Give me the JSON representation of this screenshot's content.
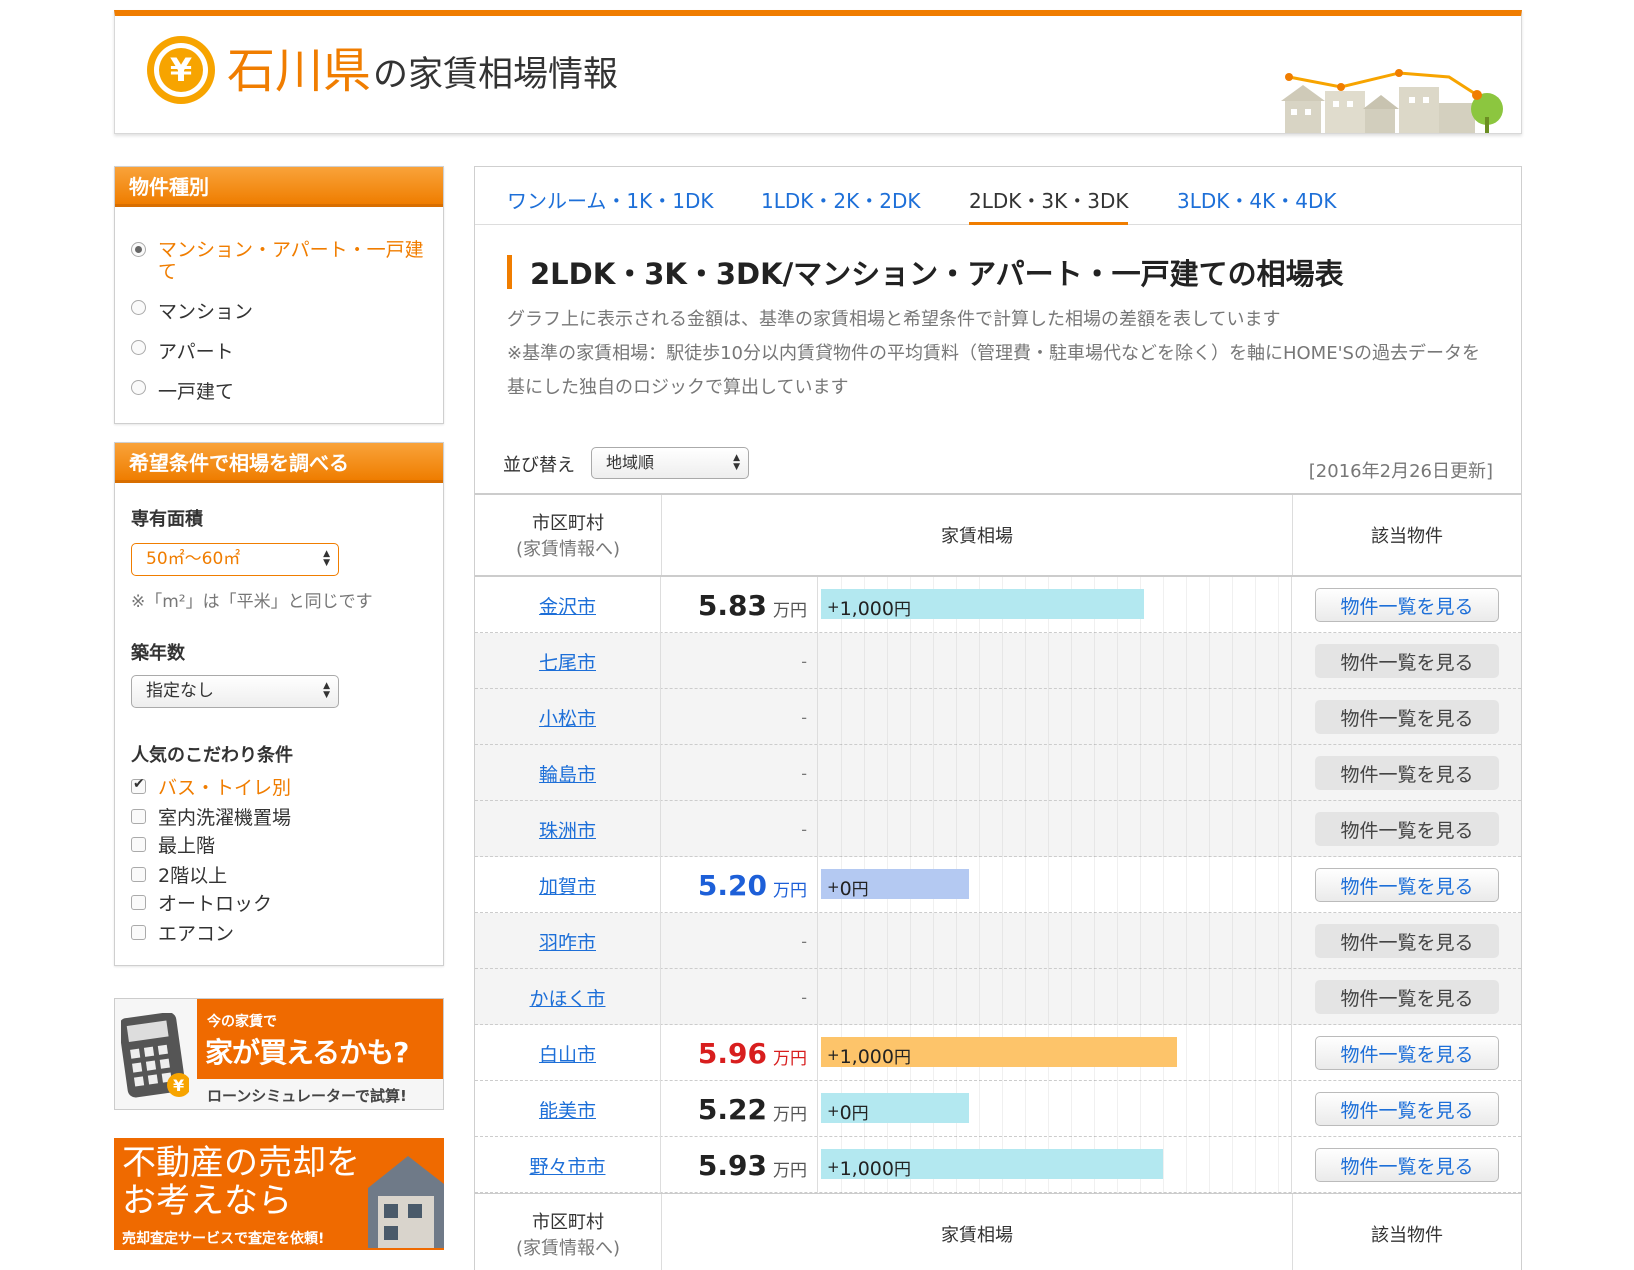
{
  "header": {
    "logo_symbol": "¥",
    "prefecture": "石川県",
    "title_rest": "の家賃相場情報"
  },
  "sidebar": {
    "property_type": {
      "heading": "物件種別",
      "options": [
        {
          "label": "マンション・アパート・一戸建て",
          "selected": true
        },
        {
          "label": "マンション",
          "selected": false
        },
        {
          "label": "アパート",
          "selected": false
        },
        {
          "label": "一戸建て",
          "selected": false
        }
      ]
    },
    "conditions": {
      "heading": "希望条件で相場を調べる",
      "area_label": "専有面積",
      "area_value": "50㎡〜60㎡",
      "area_note": "※「m²」は「平米」と同じです",
      "age_label": "築年数",
      "age_value": "指定なし",
      "popular_label": "人気のこだわり条件",
      "checks": [
        {
          "label": "バス・トイレ別",
          "checked": true
        },
        {
          "label": "室内洗濯機置場",
          "checked": false
        },
        {
          "label": "最上階",
          "checked": false
        },
        {
          "label": "2階以上",
          "checked": false
        },
        {
          "label": "オートロック",
          "checked": false
        },
        {
          "label": "エアコン",
          "checked": false
        }
      ]
    },
    "banner_loan": {
      "small": "今の家賃で",
      "big": "家が買えるかも?",
      "sub": "ローンシミュレーターで試算!"
    },
    "banner_sell": {
      "line1": "不動産の売却を",
      "line2": "お考えなら",
      "line3": "売却査定サービスで査定を依頼!"
    }
  },
  "main": {
    "tabs": [
      {
        "label": "ワンルーム・1K・1DK",
        "active": false
      },
      {
        "label": "1LDK・2K・2DK",
        "active": false
      },
      {
        "label": "2LDK・3K・3DK",
        "active": true
      },
      {
        "label": "3LDK・4K・4DK",
        "active": false
      }
    ],
    "heading": "2LDK・3K・3DK/マンション・アパート・一戸建ての相場表",
    "desc_line1": "グラフ上に表示される金額は、基準の家賃相場と希望条件で計算した相場の差額を表しています",
    "desc_line2": "※基準の家賃相場：駅徒歩10分以内賃貸物件の平均賃料（管理費・駐車場代などを除く）を軸にHOME'Sの過去データを基にした独自のロジックで算出しています",
    "sort_label": "並び替え",
    "sort_value": "地域順",
    "updated": "[2016年2月26日更新]",
    "table": {
      "col_city": "市区町村",
      "col_city_sub": "(家賃情報へ)",
      "col_rent": "家賃相場",
      "col_listings": "該当物件",
      "unit": "万円",
      "button_label": "物件一覧を見る",
      "rows": [
        {
          "city": "金沢市",
          "price": "5.83",
          "diff": "1,000",
          "bar_fraction": 0.7,
          "bar_color": "#b3e8f0",
          "tone": "normal",
          "has_data": true
        },
        {
          "city": "七尾市",
          "price": "-",
          "has_data": false
        },
        {
          "city": "小松市",
          "price": "-",
          "has_data": false
        },
        {
          "city": "輪島市",
          "price": "-",
          "has_data": false
        },
        {
          "city": "珠洲市",
          "price": "-",
          "has_data": false
        },
        {
          "city": "加賀市",
          "price": "5.20",
          "diff": "0",
          "bar_fraction": 0.32,
          "bar_color": "#b4c9f2",
          "tone": "blue",
          "has_data": true
        },
        {
          "city": "羽咋市",
          "price": "-",
          "has_data": false
        },
        {
          "city": "かほく市",
          "price": "-",
          "has_data": false
        },
        {
          "city": "白山市",
          "price": "5.96",
          "diff": "1,000",
          "bar_fraction": 0.77,
          "bar_color": "#fdc46a",
          "tone": "red",
          "has_data": true
        },
        {
          "city": "能美市",
          "price": "5.22",
          "diff": "0",
          "bar_fraction": 0.32,
          "bar_color": "#b3e8f0",
          "tone": "normal",
          "has_data": true
        },
        {
          "city": "野々市市",
          "price": "5.93",
          "diff": "1,000",
          "bar_fraction": 0.74,
          "bar_color": "#b3e8f0",
          "tone": "normal",
          "has_data": true
        }
      ]
    }
  }
}
